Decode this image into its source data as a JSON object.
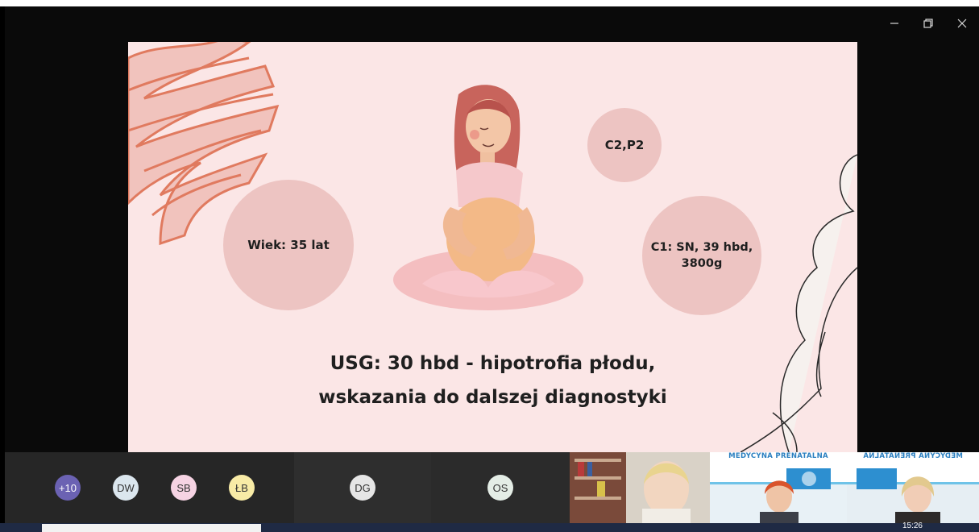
{
  "window": {
    "controls": {
      "minimize": "–",
      "restore": "❐",
      "close": "×"
    }
  },
  "slide": {
    "bubble_age": "Wiek: 35 lat",
    "bubble_cp": "C2,P2",
    "bubble_c1": "C1: SN, 39 hbd,\n3800g",
    "caption_line1": "USG: 30 hbd - hipotrofia płodu,",
    "caption_line2": "wskazania do dalszej diagnostyki",
    "colors": {
      "background": "#fbe6e6",
      "bubble": "#edc4c2",
      "accent": "#e07a5f"
    }
  },
  "participants": {
    "avatars": [
      {
        "initials": "+10",
        "color": "#6b62b3"
      },
      {
        "initials": "DW",
        "color": "#dbe6ee"
      },
      {
        "initials": "SB",
        "color": "#f6d3e3"
      },
      {
        "initials": "ŁB",
        "color": "#f8eba6"
      }
    ],
    "cams": [
      {
        "initials": "DG",
        "color": "#e6e6e6"
      },
      {
        "initials": "OS",
        "color": "#e4ede6"
      }
    ],
    "banners": [
      "MEDYCYNA PRENATALNA",
      "MEDYCYNA PRENATALNA"
    ]
  },
  "taskbar": {
    "clock": "15:26"
  }
}
